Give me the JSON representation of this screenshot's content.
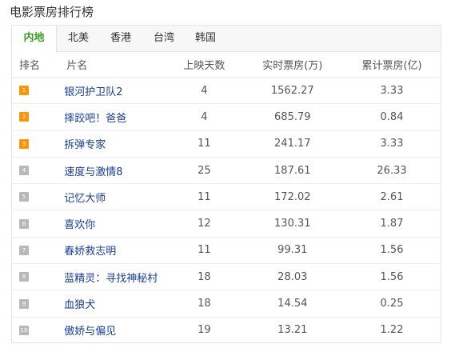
{
  "title": "电影票房排行榜",
  "tabs": [
    {
      "label": "内地",
      "active": true
    },
    {
      "label": "北美",
      "active": false
    },
    {
      "label": "香港",
      "active": false
    },
    {
      "label": "台湾",
      "active": false
    },
    {
      "label": "韩国",
      "active": false
    }
  ],
  "columns": [
    "排名",
    "片名",
    "上映天数",
    "实时票房(万)",
    "累计票房(亿)"
  ],
  "colors": {
    "accent": "#3d9a28",
    "top_badge": "#f7960d",
    "rest_badge": "#b8b8b8",
    "link": "#1a3d94"
  },
  "rows": [
    {
      "rank": "1",
      "name": "银河护卫队2",
      "days": "4",
      "realtime": "1562.27",
      "total": "3.33"
    },
    {
      "rank": "2",
      "name": "摔跤吧！爸爸",
      "days": "4",
      "realtime": "685.79",
      "total": "0.84"
    },
    {
      "rank": "3",
      "name": "拆弹专家",
      "days": "11",
      "realtime": "241.17",
      "total": "3.33"
    },
    {
      "rank": "4",
      "name": "速度与激情8",
      "days": "25",
      "realtime": "187.61",
      "total": "26.33"
    },
    {
      "rank": "5",
      "name": "记忆大师",
      "days": "11",
      "realtime": "172.02",
      "total": "2.61"
    },
    {
      "rank": "6",
      "name": "喜欢你",
      "days": "12",
      "realtime": "130.31",
      "total": "1.87"
    },
    {
      "rank": "7",
      "name": "春娇救志明",
      "days": "11",
      "realtime": "99.31",
      "total": "1.56"
    },
    {
      "rank": "8",
      "name": "蓝精灵：寻找神秘村",
      "days": "18",
      "realtime": "28.03",
      "total": "1.56"
    },
    {
      "rank": "9",
      "name": "血狼犬",
      "days": "18",
      "realtime": "14.54",
      "total": "0.25"
    },
    {
      "rank": "10",
      "name": "傲娇与偏见",
      "days": "19",
      "realtime": "13.21",
      "total": "1.22"
    }
  ]
}
